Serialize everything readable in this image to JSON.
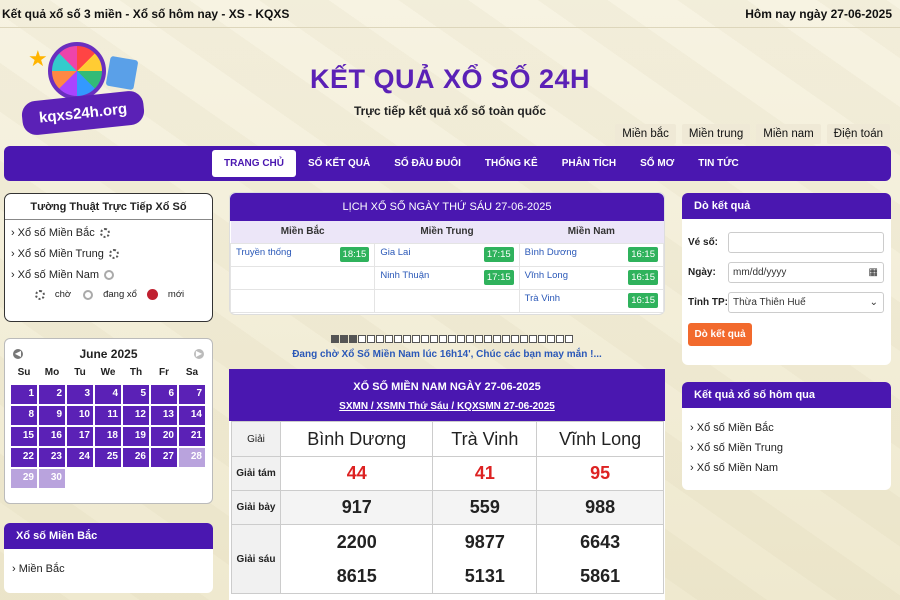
{
  "topbar": {
    "left": "Kết quả xổ số 3 miền - Xổ số hôm nay - XS - KQXS",
    "right": "Hôm nay ngày 27-06-2025"
  },
  "header": {
    "logo_text": "kqxs24h.org",
    "title": "KẾT QUẢ XỔ SỐ 24H",
    "subtitle": "Trực tiếp kết quả xổ số toàn quốc",
    "regions": [
      "Miền bắc",
      "Miền trung",
      "Miền nam",
      "Điện toán"
    ]
  },
  "nav": [
    "TRANG CHỦ",
    "SỐ KẾT QUẢ",
    "SỐ ĐẦU ĐUÔI",
    "THỐNG KÊ",
    "PHÂN TÍCH",
    "SỔ MƠ",
    "TIN TỨC"
  ],
  "live": {
    "title": "Tường Thuật Trực Tiếp Xổ Số",
    "items": [
      "Xổ số Miền Bắc",
      "Xổ số Miền Trung",
      "Xổ số Miền Nam"
    ],
    "legend": [
      "chờ",
      "đang xổ",
      "mới"
    ]
  },
  "calendar": {
    "month": "June 2025",
    "days": [
      "Su",
      "Mo",
      "Tu",
      "We",
      "Th",
      "Fr",
      "Sa"
    ],
    "dates": [
      "1",
      "2",
      "3",
      "4",
      "5",
      "6",
      "7",
      "8",
      "9",
      "10",
      "11",
      "12",
      "13",
      "14",
      "15",
      "16",
      "17",
      "18",
      "19",
      "20",
      "21",
      "22",
      "23",
      "24",
      "25",
      "26",
      "27",
      "28",
      "29",
      "30"
    ]
  },
  "mien_bac_box": {
    "title": "Xổ số Miền Bắc",
    "item": "Miền Bắc"
  },
  "schedule": {
    "title": "LỊCH XỔ SỐ NGÀY THỨ SÁU 27-06-2025",
    "cols": [
      "Miền Bắc",
      "Miền Trung",
      "Miền Nam"
    ],
    "rows": [
      [
        {
          "name": "Truyền thống",
          "time": "18:15"
        },
        {
          "name": "Gia Lai",
          "time": "17:15"
        },
        {
          "name": "Bình Dương",
          "time": "16:15"
        }
      ],
      [
        {
          "name": "",
          "time": ""
        },
        {
          "name": "Ninh Thuận",
          "time": "17:15"
        },
        {
          "name": "Vĩnh Long",
          "time": "16:15"
        }
      ],
      [
        {
          "name": "",
          "time": ""
        },
        {
          "name": "",
          "time": ""
        },
        {
          "name": "Trà Vinh",
          "time": "16:15"
        }
      ]
    ]
  },
  "progress": {
    "filled": 3,
    "total": 27
  },
  "waiting": "Đang chờ Xổ Số Miền Nam lúc 16h14', Chúc các bạn may mắn !...",
  "results": {
    "title": "XỔ SỐ MIỀN NAM NGÀY 27-06-2025",
    "links": [
      "SXMN",
      "XSMN Thứ Sáu",
      "KQXSMN 27-06-2025"
    ],
    "col_label": "Giải",
    "provinces": [
      "Bình Dương",
      "Trà Vinh",
      "Vĩnh Long"
    ],
    "rows": [
      {
        "label": "Giải tám",
        "values": [
          [
            "44"
          ],
          [
            "41"
          ],
          [
            "95"
          ]
        ],
        "red": true
      },
      {
        "label": "Giải bảy",
        "values": [
          [
            "917"
          ],
          [
            "559"
          ],
          [
            "988"
          ]
        ],
        "red": false
      },
      {
        "label": "Giải sáu",
        "values": [
          [
            "2200",
            "8615"
          ],
          [
            "9877",
            "5131"
          ],
          [
            "6643",
            "5861"
          ]
        ],
        "red": false
      }
    ]
  },
  "lookup": {
    "title": "Dò kết quả",
    "ticket_label": "Vé số:",
    "ticket_value": "",
    "date_label": "Ngày:",
    "date_placeholder": "mm/dd/yyyy",
    "province_label": "Tỉnh TP:",
    "province_value": "Thừa Thiên Huế",
    "button": "Dò kết quả"
  },
  "yesterday": {
    "title": "Kết quả xổ số hôm qua",
    "items": [
      "Xổ số Miền Bắc",
      "Xổ số Miền Trung",
      "Xổ số Miền Nam"
    ]
  }
}
